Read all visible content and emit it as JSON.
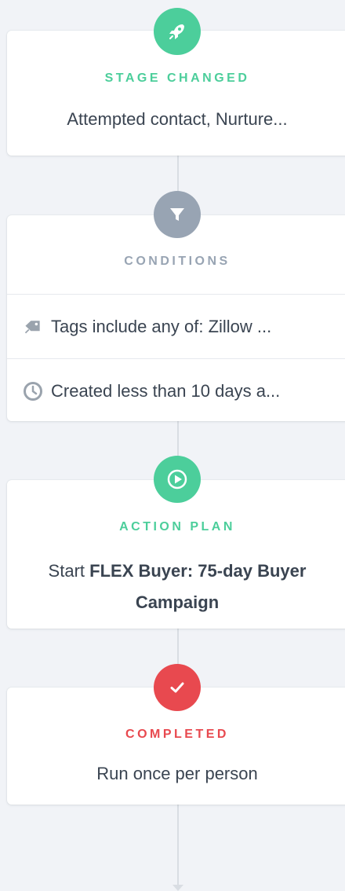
{
  "colors": {
    "green": "#4cce9b",
    "gray": "#98a4b3",
    "red": "#e8494f",
    "text": "#3a4451"
  },
  "steps": [
    {
      "icon": "rocket-icon",
      "title": "STAGE CHANGED",
      "description": "Attempted contact, Nurture..."
    },
    {
      "icon": "filter-icon",
      "title": "CONDITIONS",
      "conditions": [
        {
          "icon": "tag-icon",
          "text": "Tags include any of: Zillow ..."
        },
        {
          "icon": "clock-icon",
          "text": "Created less than 10 days a..."
        }
      ]
    },
    {
      "icon": "play-icon",
      "title": "ACTION PLAN",
      "prefix": "Start",
      "plan_name": "FLEX Buyer: 75-day Buyer",
      "plan_name_cont": "Campaign"
    },
    {
      "icon": "check-icon",
      "title": "COMPLETED",
      "description": "Run once per person"
    }
  ]
}
